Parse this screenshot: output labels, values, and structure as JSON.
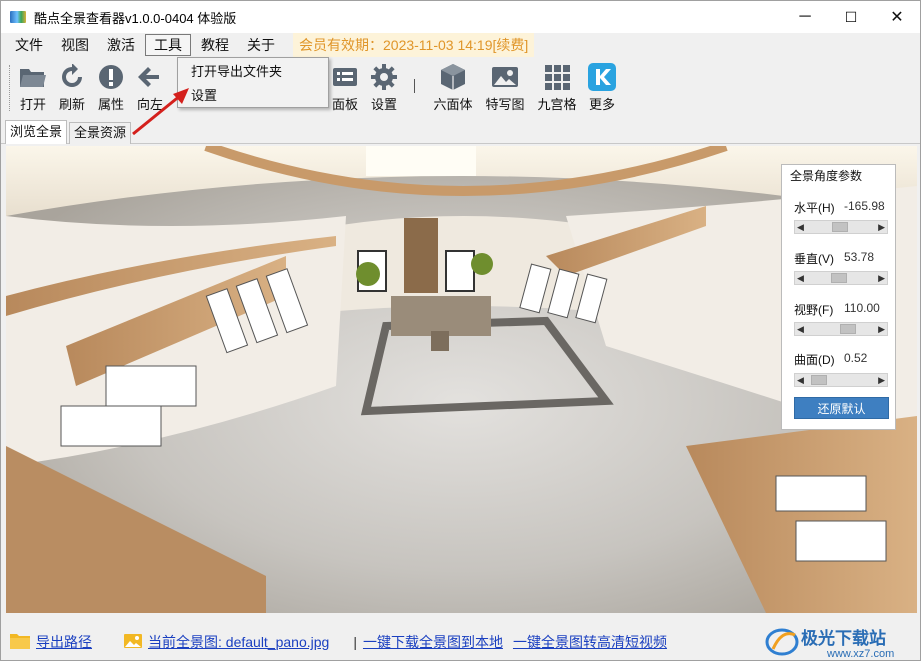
{
  "window": {
    "title": "酷点全景查看器v1.0.0-0404 体验版",
    "minimize": "─",
    "maximize": "☐",
    "close": "✕"
  },
  "menu": {
    "items": [
      "文件",
      "视图",
      "激活",
      "工具",
      "教程",
      "关于"
    ],
    "active_index": 3,
    "member_text": "会员有效期：2023-11-03 14:19[续费]"
  },
  "dropdown": {
    "items": [
      "打开导出文件夹",
      "设置"
    ]
  },
  "toolbar": {
    "open": "打开",
    "refresh": "刷新",
    "props": "属性",
    "forward": "向左",
    "panel": "面板",
    "settings": "设置",
    "cube": "六面体",
    "closeup": "特写图",
    "grid9": "九宫格",
    "more": "更多"
  },
  "tabs": [
    "浏览全景",
    "全景资源"
  ],
  "params": {
    "title": "全景角度参数",
    "horizontal_label": "水平(H)",
    "horizontal_value": "-165.98",
    "horizontal_fraction": 0.46,
    "vertical_label": "垂直(V)",
    "vertical_value": "53.78",
    "vertical_fraction": 0.45,
    "fov_label": "视野(F)",
    "fov_value": "110.00",
    "fov_fraction": 0.61,
    "curve_label": "曲面(D)",
    "curve_value": "0.52",
    "curve_fraction": 0.08,
    "reset_label": "还原默认"
  },
  "status": {
    "export_path": "导出路径",
    "current_pano": "当前全景图:  default_pano.jpg",
    "download": "一键下载全景图到本地",
    "to_video": "一键全景图转高清短视频"
  },
  "watermark": {
    "text": "极光下载站",
    "url": "www.xz7.com"
  },
  "colors": {
    "member_bg": "#fdf3d9",
    "member_text": "#e0962a",
    "link": "#1a3fc0",
    "reset_btn": "#3e7fc1",
    "arrow": "#d4201c",
    "more_icon": "#2aa3e0"
  }
}
